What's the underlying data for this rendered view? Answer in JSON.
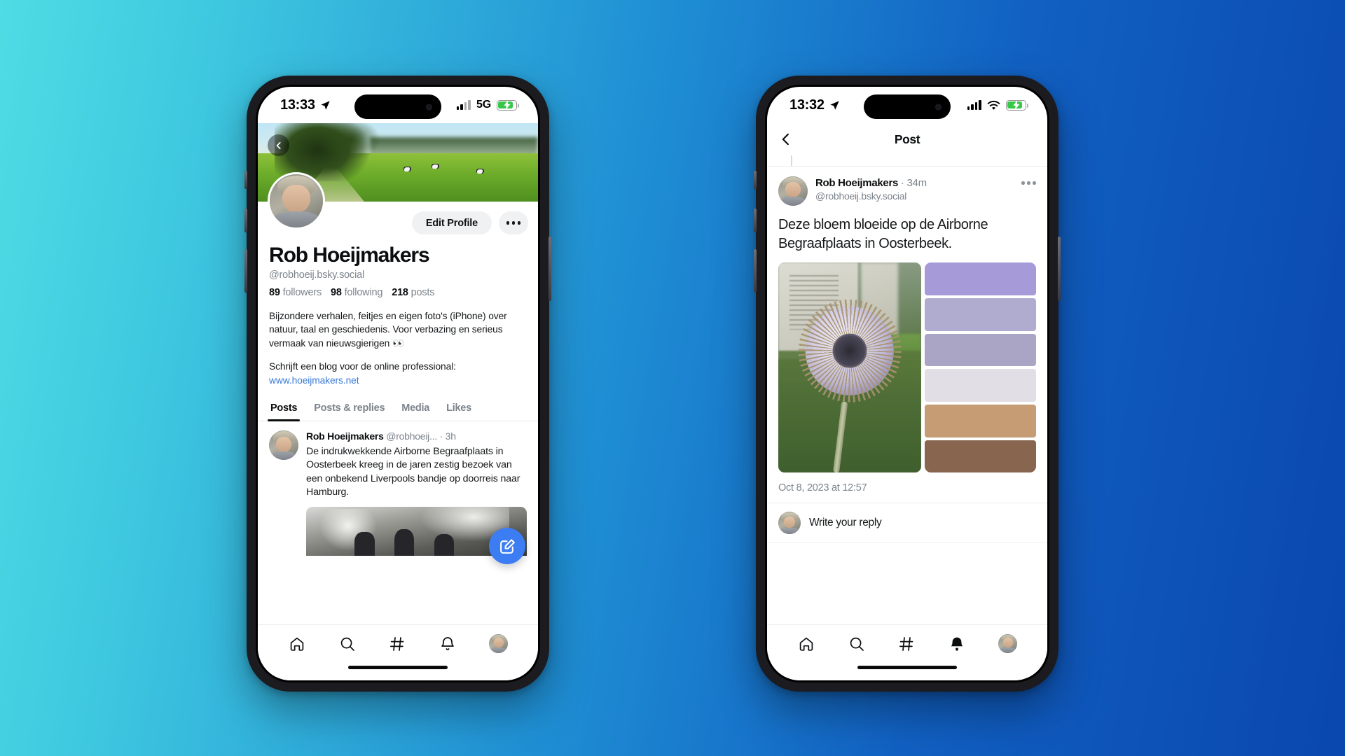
{
  "background": {
    "from": "#4fdce4",
    "to": "#0a47ae"
  },
  "phones": {
    "left": {
      "status": {
        "time": "13:33",
        "network": "5G",
        "battery_charging": true,
        "location_arrow": "location-arrow-icon"
      },
      "profile": {
        "back_icon": "chevron-left-icon",
        "edit_button": "Edit Profile",
        "more_button": "more-horizontal-icon",
        "display_name": "Rob Hoeijmakers",
        "handle": "@robhoeij.bsky.social",
        "stats": [
          {
            "count": "89",
            "label": "followers"
          },
          {
            "count": "98",
            "label": "following"
          },
          {
            "count": "218",
            "label": "posts"
          }
        ],
        "bio_paragraph_1": "Bijzondere verhalen, feitjes en eigen foto's (iPhone) over natuur, taal en geschiedenis. Voor verbazing en serieus vermaak van nieuwsgierigen 👀",
        "bio_paragraph_2": "Schrijft een blog voor de online professional:",
        "bio_link": "www.hoeijmakers.net"
      },
      "tabs": [
        {
          "label": "Posts",
          "active": true
        },
        {
          "label": "Posts & replies",
          "active": false
        },
        {
          "label": "Media",
          "active": false
        },
        {
          "label": "Likes",
          "active": false
        }
      ],
      "feed_post": {
        "author": "Rob Hoeijmakers",
        "handle": "@robhoeij...",
        "separator": "·",
        "time": "3h",
        "text": "De indrukwekkende Airborne Begraafplaats in Oosterbeek kreeg in de jaren zestig bezoek van een onbekend Liverpools bandje op doorreis naar Hamburg."
      },
      "compose_fab": "compose-icon",
      "tabbar": [
        {
          "name": "home-icon",
          "active": false
        },
        {
          "name": "search-icon",
          "active": false
        },
        {
          "name": "hashtag-icon",
          "active": false
        },
        {
          "name": "bell-icon",
          "active": false
        },
        {
          "name": "profile-avatar",
          "active": false
        }
      ]
    },
    "right": {
      "status": {
        "time": "13:32",
        "network": "wifi",
        "battery_charging": true,
        "location_arrow": "location-arrow-icon"
      },
      "navbar": {
        "back_icon": "chevron-left-icon",
        "title": "Post"
      },
      "post": {
        "author": "Rob Hoeijmakers",
        "separator": "·",
        "time": "34m",
        "handle": "@robhoeij.bsky.social",
        "more_button": "more-horizontal-icon",
        "text": "Deze bloem bloeide op de Airborne Begraafplaats in Oosterbeek.",
        "timestamp": "Oct 8, 2023 at 12:57",
        "swatches": [
          "#a79ad8",
          "#b0acd0",
          "#aba5c5",
          "#e2dee5",
          "#c59c74",
          "#87654e"
        ]
      },
      "reply": {
        "placeholder": "Write your reply"
      },
      "tabbar": [
        {
          "name": "home-icon",
          "active": false
        },
        {
          "name": "search-icon",
          "active": false
        },
        {
          "name": "hashtag-icon",
          "active": false
        },
        {
          "name": "bell-icon",
          "active": true
        },
        {
          "name": "profile-avatar",
          "active": false
        }
      ]
    }
  }
}
